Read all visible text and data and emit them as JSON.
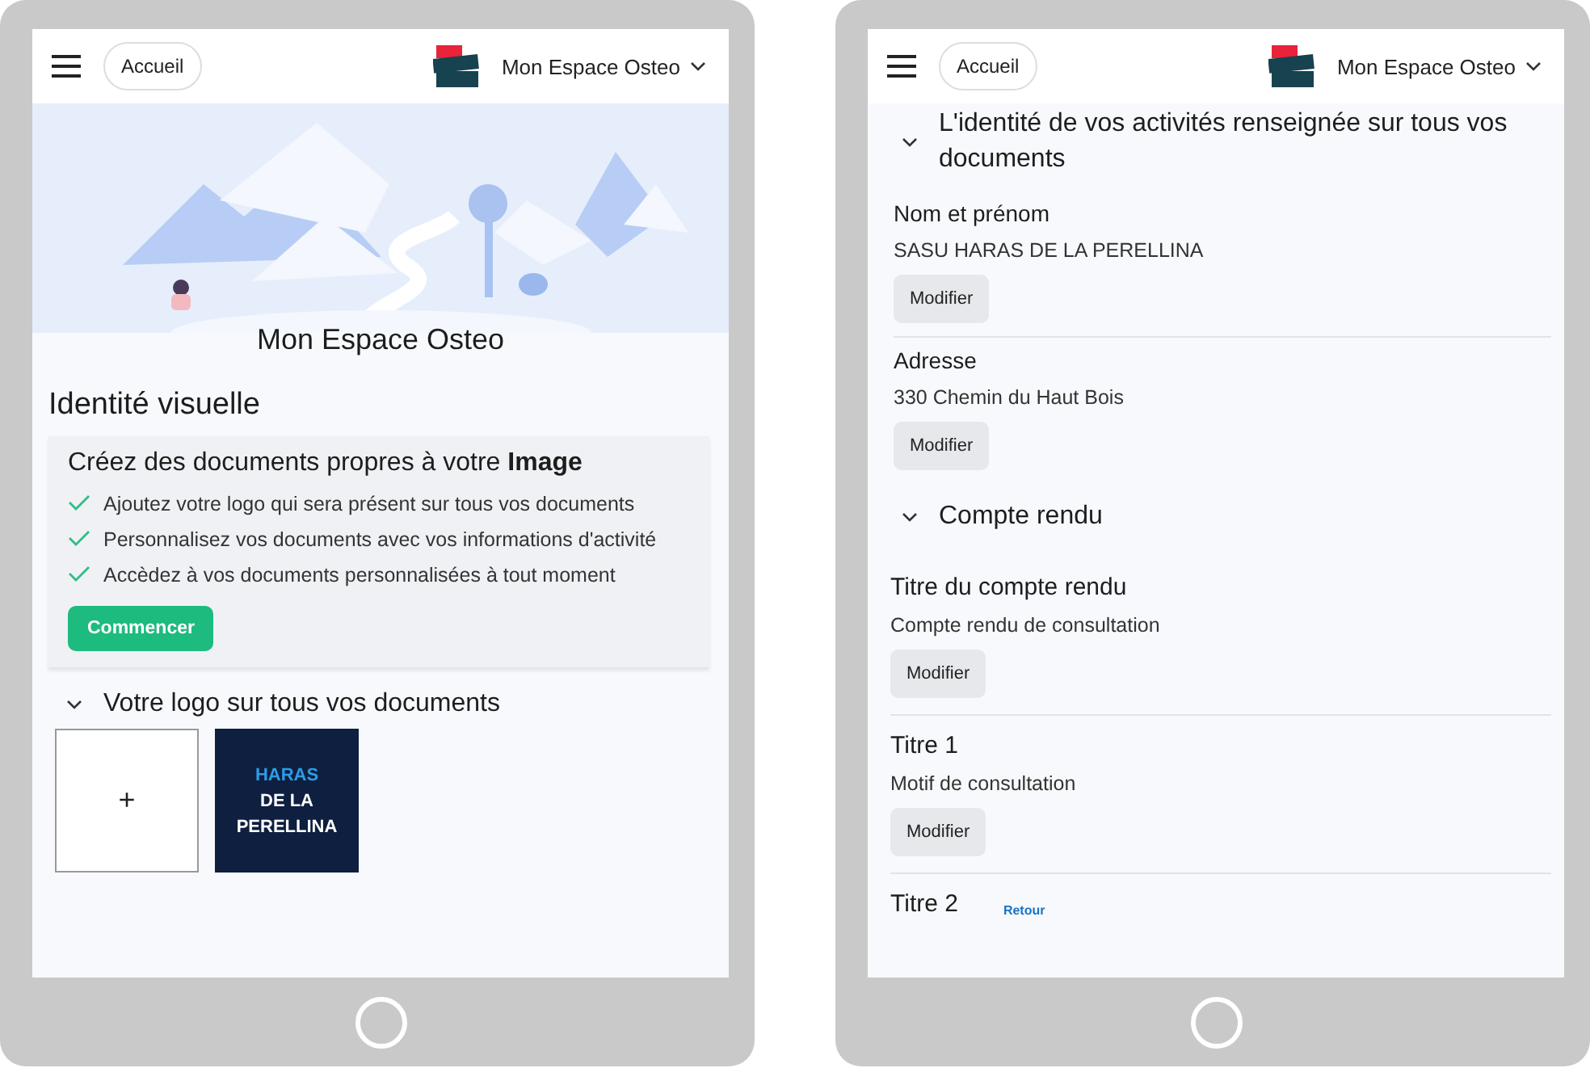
{
  "left_screen": {
    "header": {
      "home_button": "Accueil",
      "account": "Mon Espace Osteo"
    },
    "hero_title": "Mon Espace Osteo",
    "heading": "Identité visuelle",
    "intro_card": {
      "title": "Créez des documents propres à votre **Image**",
      "features": [
        "Ajoutez votre logo qui sera présent sur tous vos documents",
        "Personnalisez vos documents avec vos informations d'activité",
        "Accèdez à vos documents personnalisées à tout moment"
      ],
      "button": "Commencer"
    },
    "logo_section": {
      "title": "Votre logo sur tous vos documents",
      "expanded": true,
      "add_tile": "+",
      "logo_lines": [
        "HARAS",
        "DE LA",
        "PERELLINA"
      ]
    }
  },
  "right_screen": {
    "header": {
      "home_button": "Accueil",
      "account": "Mon Espace Osteo"
    },
    "sections": [
      {
        "title": "L'identité de vos activités renseignée sur tous vos documents",
        "expanded": true,
        "fields": [
          {
            "label": "Nom et prénom",
            "value": "SASU HARAS DE LA PERELLINA",
            "button": "Modifier"
          },
          {
            "label": "Adresse",
            "value": "330 Chemin du Haut Bois",
            "button": "Modifier"
          }
        ]
      },
      {
        "title": "Compte rendu",
        "expanded": true,
        "fields": [
          {
            "label": "Titre du compte rendu",
            "value": "Compte rendu de consultation",
            "button": "Modifier"
          },
          {
            "label": "Titre 1",
            "value": "Motif de consultation",
            "button": "Modifier"
          },
          {
            "label": "Titre 2",
            "link": "Retour"
          }
        ]
      }
    ]
  }
}
